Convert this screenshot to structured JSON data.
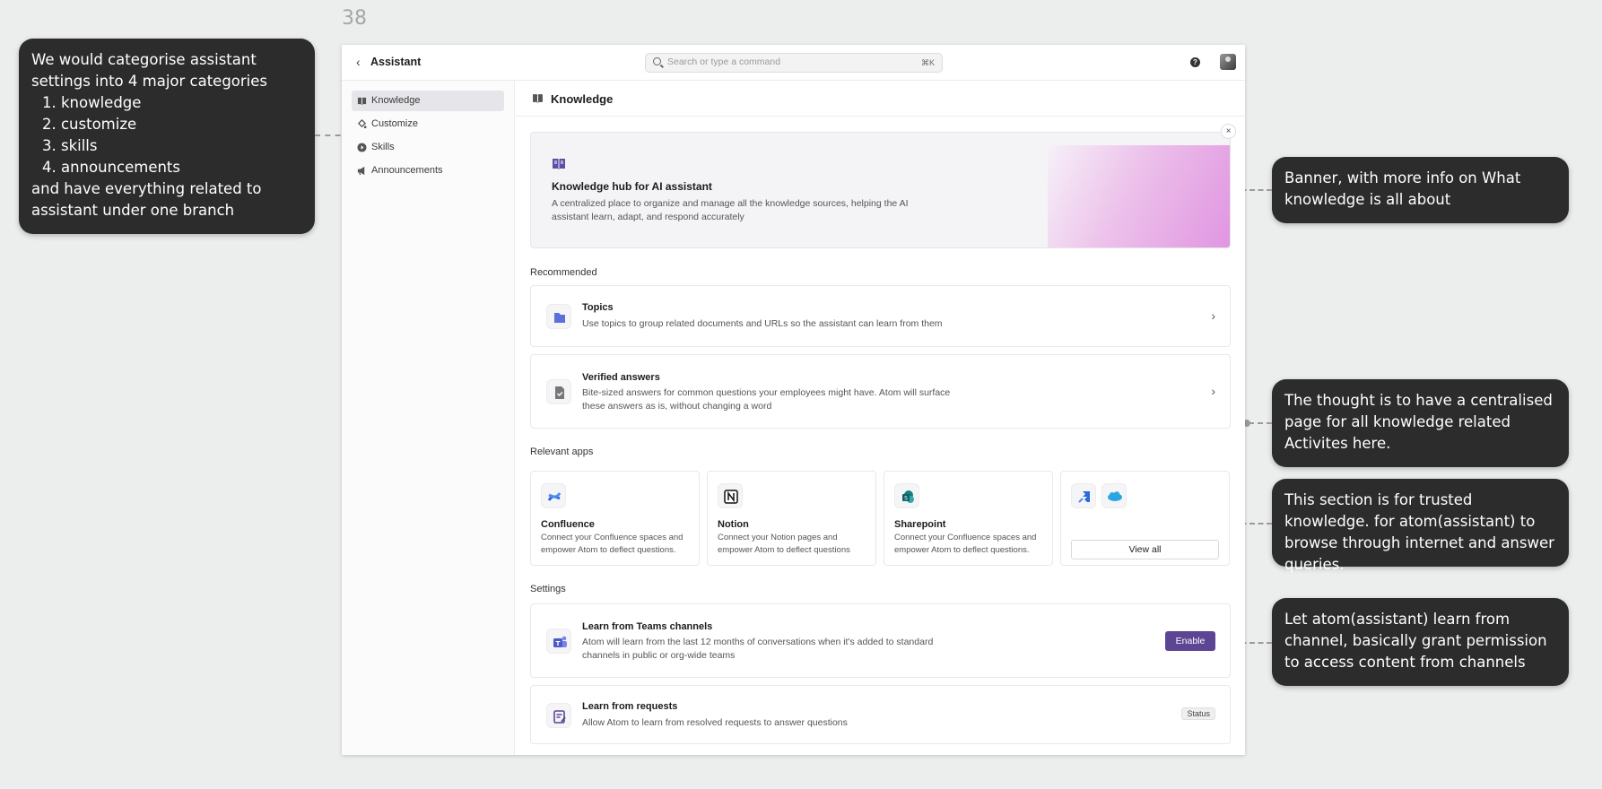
{
  "frame_number": "38",
  "annotations": {
    "left": [
      "We would categorise assistant",
      "settings into 4 major categories",
      "1. knowledge",
      "2. customize",
      "3. skills",
      "4. announcements",
      "and have everything related to",
      "assistant under one branch"
    ],
    "banner": "Banner, with more info on What knowledge is all about",
    "central": "The thought is to have a centralised page for all knowledge related Activites here.",
    "trusted": "This section is for trusted knowledge. for atom(assistant) to browse through internet and answer queries.",
    "channel": "Let atom(assistant) learn from channel, basically grant permission to access content from channels"
  },
  "topbar": {
    "back_icon": "chevron-left-icon",
    "title": "Assistant",
    "search_placeholder": "Search or type a command",
    "search_shortcut": "⌘K",
    "help_label": "?"
  },
  "sidebar": {
    "items": [
      {
        "label": "Knowledge",
        "icon": "book-icon",
        "active": true
      },
      {
        "label": "Customize",
        "icon": "paint-bucket-icon",
        "active": false
      },
      {
        "label": "Skills",
        "icon": "play-circle-icon",
        "active": false
      },
      {
        "label": "Announcements",
        "icon": "megaphone-icon",
        "active": false
      }
    ]
  },
  "page": {
    "title": "Knowledge",
    "banner": {
      "title": "Knowledge hub for AI assistant",
      "description": "A centralized place to organize and manage all the knowledge sources, helping the AI assistant learn, adapt, and respond accurately",
      "close_label": "×"
    },
    "recommended_label": "Recommended",
    "recommended": [
      {
        "title": "Topics",
        "description": "Use topics to group related documents and URLs so the assistant can learn from them",
        "icon": "folder-icon"
      },
      {
        "title": "Verified answers",
        "description": "Bite-sized answers for common questions your employees might have. Atom will surface these answers as is, without changing a word",
        "icon": "verified-doc-icon"
      }
    ],
    "apps_label": "Relevant apps",
    "apps": [
      {
        "title": "Confluence",
        "description": "Connect your Confluence spaces and empower Atom to deflect questions.",
        "icon": "confluence-icon"
      },
      {
        "title": "Notion",
        "description": "Connect your Notion pages and empower Atom to deflect questions",
        "icon": "notion-icon"
      },
      {
        "title": "Sharepoint",
        "description": "Connect your Confluence spaces and empower Atom to deflect questions.",
        "icon": "sharepoint-icon"
      }
    ],
    "view_all_label": "View all",
    "settings_label": "Settings",
    "settings": [
      {
        "title": "Learn from Teams channels",
        "description": "Atom will learn from the last 12 months of conversations when it's added to standard channels in public or org-wide teams",
        "action": "Enable",
        "icon": "teams-icon"
      },
      {
        "title": "Learn from requests",
        "description": "Allow Atom to learn from resolved requests to answer questions",
        "action": "Status",
        "icon": "edit-list-icon"
      }
    ]
  },
  "colors": {
    "accent": "#5c4592",
    "annotation_bg": "#2c2c2c",
    "canvas": "#eceded"
  }
}
